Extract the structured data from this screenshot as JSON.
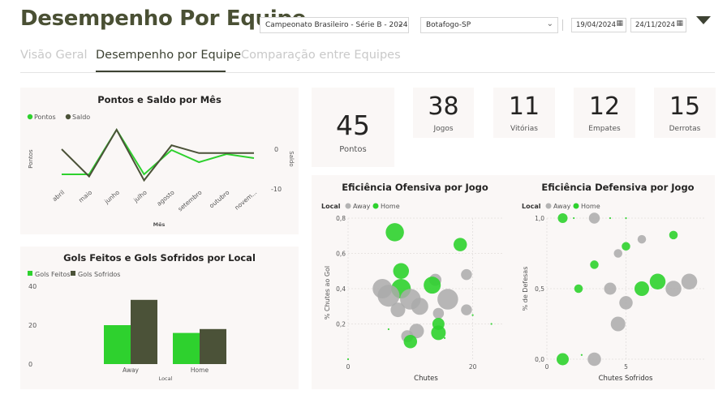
{
  "header": {
    "title": "Desempenho Por Equipe"
  },
  "filters": {
    "competition": "Campeonato Brasileiro - Série B - 2024",
    "team": "Botafogo-SP",
    "date_start": "19/04/2024",
    "date_end": "24/11/2024"
  },
  "tabs": [
    {
      "label": "Visão Geral",
      "active": false
    },
    {
      "label": "Desempenho por Equipe",
      "active": true
    },
    {
      "label": "Comparação entre Equipes",
      "active": false
    }
  ],
  "kpis": {
    "points": {
      "value": "45",
      "label": "Pontos"
    },
    "games": {
      "value": "38",
      "label": "Jogos"
    },
    "wins": {
      "value": "11",
      "label": "Vitórias"
    },
    "draws": {
      "value": "12",
      "label": "Empates"
    },
    "losses": {
      "value": "15",
      "label": "Derrotas"
    }
  },
  "colors": {
    "points": "#2ed12e",
    "balance": "#4b5238",
    "away": "#b3b3b3",
    "home": "#2ed12e",
    "title": "#4a5034"
  },
  "chart_data": [
    {
      "id": "monthly",
      "type": "line",
      "title": "Pontos e Saldo por Mês",
      "categories": [
        "abril",
        "maio",
        "junho",
        "julho",
        "agosto",
        "setembro",
        "outubro",
        "novem..."
      ],
      "series": [
        {
          "name": "Pontos",
          "axis": "left",
          "values": [
            2,
            2,
            13,
            2,
            8,
            5,
            7,
            6
          ]
        },
        {
          "name": "Saldo",
          "axis": "right",
          "values": [
            0,
            -7,
            5,
            -8,
            1,
            -1,
            -1,
            -1
          ]
        }
      ],
      "ylabel": "Pontos",
      "y2label": "Saldo",
      "xlabel": "Mês",
      "y2_ticks": [
        "0",
        "-10"
      ],
      "legend": "top-left"
    },
    {
      "id": "goals",
      "type": "bar",
      "title": "Gols Feitos e Gols Sofridos por Local",
      "categories": [
        "Away",
        "Home"
      ],
      "series": [
        {
          "name": "Gols Feitos",
          "values": [
            20,
            16
          ]
        },
        {
          "name": "Gols Sofridos",
          "values": [
            33,
            18
          ]
        }
      ],
      "xlabel": "Local",
      "yticks": [
        0,
        20,
        40
      ],
      "ylim": [
        0,
        40
      ],
      "legend": "top-left"
    },
    {
      "id": "offense",
      "type": "scatter",
      "title": "Eficiência Ofensiva por Jogo",
      "legend_title": "Local",
      "legend_items": [
        "Away",
        "Home"
      ],
      "xlabel": "Chutes",
      "ylabel": "% Chutes ao Gol",
      "xticks": [
        "0",
        "20"
      ],
      "yticks": [
        "0,8",
        "0,6",
        "0,4",
        "0,2"
      ],
      "xlim": [
        0,
        25
      ],
      "ylim": [
        0,
        0.8
      ],
      "points": [
        {
          "x": 7.5,
          "y": 0.72,
          "size": 15,
          "local": "Home"
        },
        {
          "x": 18,
          "y": 0.65,
          "size": 11,
          "local": "Home"
        },
        {
          "x": 19,
          "y": 0.48,
          "size": 9,
          "local": "Away"
        },
        {
          "x": 8.5,
          "y": 0.5,
          "size": 13,
          "local": "Home"
        },
        {
          "x": 14,
          "y": 0.45,
          "size": 10,
          "local": "Away"
        },
        {
          "x": 13.5,
          "y": 0.42,
          "size": 14,
          "local": "Home"
        },
        {
          "x": 5.5,
          "y": 0.4,
          "size": 16,
          "local": "Away"
        },
        {
          "x": 8.5,
          "y": 0.4,
          "size": 16,
          "local": "Home"
        },
        {
          "x": 6.5,
          "y": 0.36,
          "size": 18,
          "local": "Away"
        },
        {
          "x": 10,
          "y": 0.34,
          "size": 17,
          "local": "Away"
        },
        {
          "x": 16,
          "y": 0.34,
          "size": 17,
          "local": "Away"
        },
        {
          "x": 11.5,
          "y": 0.3,
          "size": 14,
          "local": "Away"
        },
        {
          "x": 8,
          "y": 0.28,
          "size": 12,
          "local": "Away"
        },
        {
          "x": 19,
          "y": 0.28,
          "size": 9,
          "local": "Away"
        },
        {
          "x": 14.5,
          "y": 0.26,
          "size": 9,
          "local": "Away"
        },
        {
          "x": 14.5,
          "y": 0.2,
          "size": 10,
          "local": "Home"
        },
        {
          "x": 11,
          "y": 0.16,
          "size": 12,
          "local": "Away"
        },
        {
          "x": 14.5,
          "y": 0.15,
          "size": 12,
          "local": "Home"
        },
        {
          "x": 9.5,
          "y": 0.13,
          "size": 10,
          "local": "Away"
        },
        {
          "x": 10,
          "y": 0.1,
          "size": 11,
          "local": "Home"
        },
        {
          "x": 20,
          "y": 0.25,
          "size": 1.5,
          "local": "Home"
        },
        {
          "x": 23,
          "y": 0.2,
          "size": 1.5,
          "local": "Home"
        },
        {
          "x": 6.5,
          "y": 0.17,
          "size": 1.5,
          "local": "Home"
        },
        {
          "x": 15.5,
          "y": 0.12,
          "size": 1.5,
          "local": "Home"
        },
        {
          "x": 0,
          "y": 0.0,
          "size": 1.5,
          "local": "Home"
        }
      ]
    },
    {
      "id": "defense",
      "type": "scatter",
      "title": "Eficiência Defensiva por Jogo",
      "legend_title": "Local",
      "legend_items": [
        "Away",
        "Home"
      ],
      "xlabel": "Chutes Sofridos",
      "ylabel": "% de Defesas",
      "xticks": [
        "0",
        "5"
      ],
      "yticks": [
        "1,0",
        "0,5",
        "0,0"
      ],
      "xlim": [
        0,
        10
      ],
      "ylim": [
        0,
        1.0
      ],
      "points": [
        {
          "x": 1,
          "y": 1.0,
          "size": 8,
          "local": "Home"
        },
        {
          "x": 3,
          "y": 1.0,
          "size": 9,
          "local": "Away"
        },
        {
          "x": 1.7,
          "y": 1.0,
          "size": 1.5,
          "local": "Home"
        },
        {
          "x": 4,
          "y": 1.0,
          "size": 1.5,
          "local": "Home"
        },
        {
          "x": 5,
          "y": 1.0,
          "size": 1.5,
          "local": "Home"
        },
        {
          "x": 8,
          "y": 0.88,
          "size": 7,
          "local": "Home"
        },
        {
          "x": 6,
          "y": 0.85,
          "size": 7,
          "local": "Away"
        },
        {
          "x": 5,
          "y": 0.8,
          "size": 7,
          "local": "Home"
        },
        {
          "x": 4.5,
          "y": 0.75,
          "size": 7,
          "local": "Away"
        },
        {
          "x": 3,
          "y": 0.67,
          "size": 7,
          "local": "Home"
        },
        {
          "x": 2,
          "y": 0.5,
          "size": 7,
          "local": "Home"
        },
        {
          "x": 4,
          "y": 0.5,
          "size": 10,
          "local": "Away"
        },
        {
          "x": 5,
          "y": 0.4,
          "size": 11,
          "local": "Away"
        },
        {
          "x": 6,
          "y": 0.5,
          "size": 12,
          "local": "Home"
        },
        {
          "x": 7,
          "y": 0.55,
          "size": 13,
          "local": "Home"
        },
        {
          "x": 8,
          "y": 0.5,
          "size": 13,
          "local": "Away"
        },
        {
          "x": 9,
          "y": 0.55,
          "size": 13,
          "local": "Away"
        },
        {
          "x": 4.5,
          "y": 0.25,
          "size": 12,
          "local": "Away"
        },
        {
          "x": 1,
          "y": 0.0,
          "size": 10,
          "local": "Home"
        },
        {
          "x": 3,
          "y": 0.0,
          "size": 11,
          "local": "Away"
        },
        {
          "x": 2.2,
          "y": 0.03,
          "size": 1.5,
          "local": "Home"
        }
      ]
    }
  ]
}
